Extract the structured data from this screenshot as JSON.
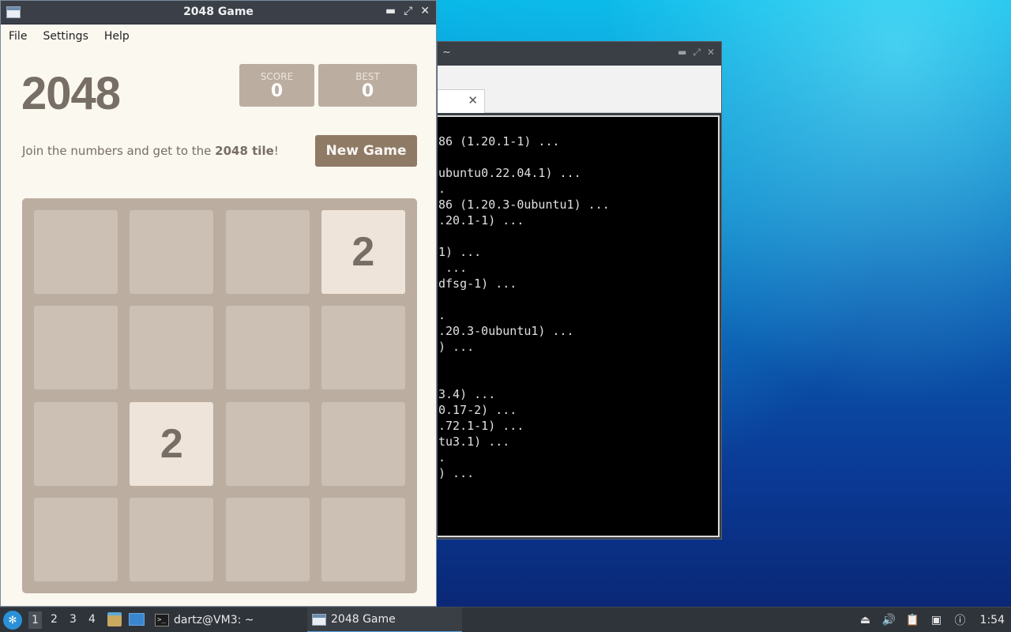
{
  "terminal": {
    "title": "~",
    "lines": [
      "86 (1.20.1-1) ...",
      "",
      "ubuntu0.22.04.1) ...",
      ".",
      "86 (1.20.3-0ubuntu1) ...",
      ".20.1-1) ...",
      "",
      "1) ...",
      " ...",
      "dfsg-1) ...",
      "",
      ".",
      ".20.3-0ubuntu1) ...",
      ") ...",
      "",
      "",
      "3.4) ...",
      "0.17-2) ...",
      ".72.1-1) ...",
      "tu3.1) ...",
      ".",
      ") ..."
    ]
  },
  "game_window": {
    "title": "2048 Game",
    "menu": [
      "File",
      "Settings",
      "Help"
    ]
  },
  "game": {
    "logo": "2048",
    "score_label": "SCORE",
    "score_value": "0",
    "best_label": "BEST",
    "best_value": "0",
    "intro_pre": "Join the numbers and get to the ",
    "intro_bold": "2048 tile",
    "intro_post": "!",
    "new_game_label": "New Game",
    "board": [
      [
        "",
        "",
        "",
        "2"
      ],
      [
        "",
        "",
        "",
        ""
      ],
      [
        "",
        "2",
        "",
        ""
      ],
      [
        "",
        "",
        "",
        ""
      ]
    ],
    "tile_color_2": "#eee4da",
    "board_color": "#bbada0"
  },
  "taskbar": {
    "workspaces": [
      "1",
      "2",
      "3",
      "4"
    ],
    "active_workspace": "1",
    "tasks": [
      {
        "label": "dartz@VM3: ~",
        "icon": "terminal-icon"
      },
      {
        "label": "2048 Game",
        "icon": "app-window-icon"
      }
    ],
    "clock": "1:54"
  }
}
